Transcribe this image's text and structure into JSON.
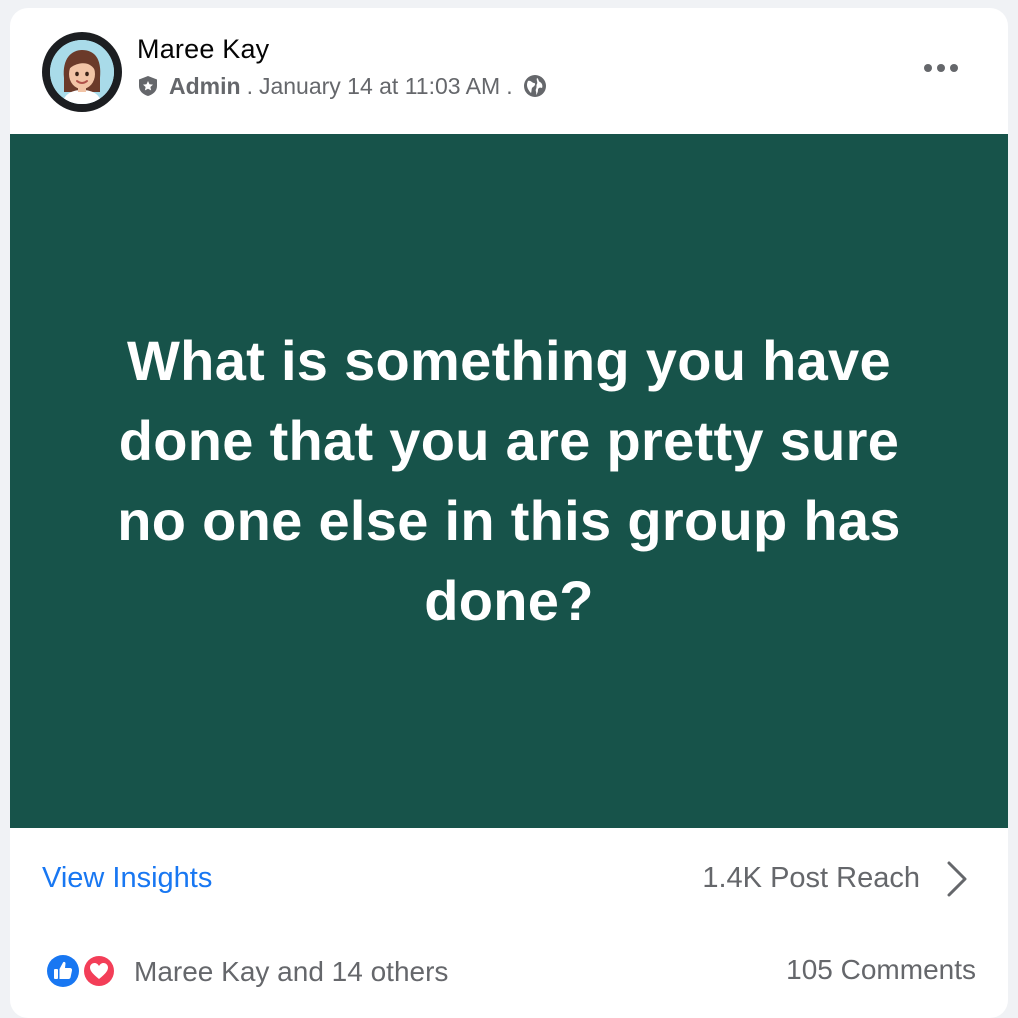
{
  "post": {
    "author": "Maree Kay",
    "role": "Admin",
    "separator": ".",
    "timestamp": "January 14 at 11:03 AM",
    "privacy_icon": "globe-icon",
    "role_icon": "admin-shield-icon",
    "more_icon": "more-horizontal-icon",
    "background_color": "#17534a",
    "text": "What is something you have done that you are pretty sure no one else in this group has done?"
  },
  "insights": {
    "link_label": "View Insights",
    "reach_label": "1.4K Post Reach",
    "chevron_icon": "chevron-right-icon"
  },
  "reactions": {
    "icons": [
      "like-icon",
      "love-icon"
    ],
    "summary": "Maree Kay and 14 others",
    "comments": "105 Comments"
  },
  "colors": {
    "accent": "#1877f2",
    "secondary_text": "#65676b",
    "love": "#f33e58"
  }
}
